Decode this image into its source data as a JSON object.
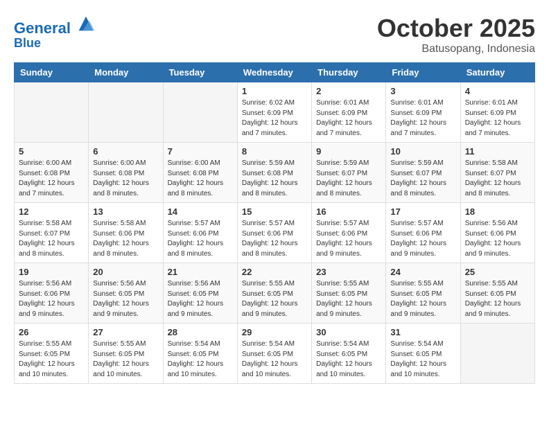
{
  "header": {
    "logo_line1": "General",
    "logo_line2": "Blue",
    "month_title": "October 2025",
    "location": "Batusopang, Indonesia"
  },
  "weekdays": [
    "Sunday",
    "Monday",
    "Tuesday",
    "Wednesday",
    "Thursday",
    "Friday",
    "Saturday"
  ],
  "weeks": [
    [
      {
        "day": "",
        "info": ""
      },
      {
        "day": "",
        "info": ""
      },
      {
        "day": "",
        "info": ""
      },
      {
        "day": "1",
        "info": "Sunrise: 6:02 AM\nSunset: 6:09 PM\nDaylight: 12 hours and 7 minutes."
      },
      {
        "day": "2",
        "info": "Sunrise: 6:01 AM\nSunset: 6:09 PM\nDaylight: 12 hours and 7 minutes."
      },
      {
        "day": "3",
        "info": "Sunrise: 6:01 AM\nSunset: 6:09 PM\nDaylight: 12 hours and 7 minutes."
      },
      {
        "day": "4",
        "info": "Sunrise: 6:01 AM\nSunset: 6:09 PM\nDaylight: 12 hours and 7 minutes."
      }
    ],
    [
      {
        "day": "5",
        "info": "Sunrise: 6:00 AM\nSunset: 6:08 PM\nDaylight: 12 hours and 7 minutes."
      },
      {
        "day": "6",
        "info": "Sunrise: 6:00 AM\nSunset: 6:08 PM\nDaylight: 12 hours and 8 minutes."
      },
      {
        "day": "7",
        "info": "Sunrise: 6:00 AM\nSunset: 6:08 PM\nDaylight: 12 hours and 8 minutes."
      },
      {
        "day": "8",
        "info": "Sunrise: 5:59 AM\nSunset: 6:08 PM\nDaylight: 12 hours and 8 minutes."
      },
      {
        "day": "9",
        "info": "Sunrise: 5:59 AM\nSunset: 6:07 PM\nDaylight: 12 hours and 8 minutes."
      },
      {
        "day": "10",
        "info": "Sunrise: 5:59 AM\nSunset: 6:07 PM\nDaylight: 12 hours and 8 minutes."
      },
      {
        "day": "11",
        "info": "Sunrise: 5:58 AM\nSunset: 6:07 PM\nDaylight: 12 hours and 8 minutes."
      }
    ],
    [
      {
        "day": "12",
        "info": "Sunrise: 5:58 AM\nSunset: 6:07 PM\nDaylight: 12 hours and 8 minutes."
      },
      {
        "day": "13",
        "info": "Sunrise: 5:58 AM\nSunset: 6:06 PM\nDaylight: 12 hours and 8 minutes."
      },
      {
        "day": "14",
        "info": "Sunrise: 5:57 AM\nSunset: 6:06 PM\nDaylight: 12 hours and 8 minutes."
      },
      {
        "day": "15",
        "info": "Sunrise: 5:57 AM\nSunset: 6:06 PM\nDaylight: 12 hours and 8 minutes."
      },
      {
        "day": "16",
        "info": "Sunrise: 5:57 AM\nSunset: 6:06 PM\nDaylight: 12 hours and 9 minutes."
      },
      {
        "day": "17",
        "info": "Sunrise: 5:57 AM\nSunset: 6:06 PM\nDaylight: 12 hours and 9 minutes."
      },
      {
        "day": "18",
        "info": "Sunrise: 5:56 AM\nSunset: 6:06 PM\nDaylight: 12 hours and 9 minutes."
      }
    ],
    [
      {
        "day": "19",
        "info": "Sunrise: 5:56 AM\nSunset: 6:06 PM\nDaylight: 12 hours and 9 minutes."
      },
      {
        "day": "20",
        "info": "Sunrise: 5:56 AM\nSunset: 6:05 PM\nDaylight: 12 hours and 9 minutes."
      },
      {
        "day": "21",
        "info": "Sunrise: 5:56 AM\nSunset: 6:05 PM\nDaylight: 12 hours and 9 minutes."
      },
      {
        "day": "22",
        "info": "Sunrise: 5:55 AM\nSunset: 6:05 PM\nDaylight: 12 hours and 9 minutes."
      },
      {
        "day": "23",
        "info": "Sunrise: 5:55 AM\nSunset: 6:05 PM\nDaylight: 12 hours and 9 minutes."
      },
      {
        "day": "24",
        "info": "Sunrise: 5:55 AM\nSunset: 6:05 PM\nDaylight: 12 hours and 9 minutes."
      },
      {
        "day": "25",
        "info": "Sunrise: 5:55 AM\nSunset: 6:05 PM\nDaylight: 12 hours and 9 minutes."
      }
    ],
    [
      {
        "day": "26",
        "info": "Sunrise: 5:55 AM\nSunset: 6:05 PM\nDaylight: 12 hours and 10 minutes."
      },
      {
        "day": "27",
        "info": "Sunrise: 5:55 AM\nSunset: 6:05 PM\nDaylight: 12 hours and 10 minutes."
      },
      {
        "day": "28",
        "info": "Sunrise: 5:54 AM\nSunset: 6:05 PM\nDaylight: 12 hours and 10 minutes."
      },
      {
        "day": "29",
        "info": "Sunrise: 5:54 AM\nSunset: 6:05 PM\nDaylight: 12 hours and 10 minutes."
      },
      {
        "day": "30",
        "info": "Sunrise: 5:54 AM\nSunset: 6:05 PM\nDaylight: 12 hours and 10 minutes."
      },
      {
        "day": "31",
        "info": "Sunrise: 5:54 AM\nSunset: 6:05 PM\nDaylight: 12 hours and 10 minutes."
      },
      {
        "day": "",
        "info": ""
      }
    ]
  ]
}
